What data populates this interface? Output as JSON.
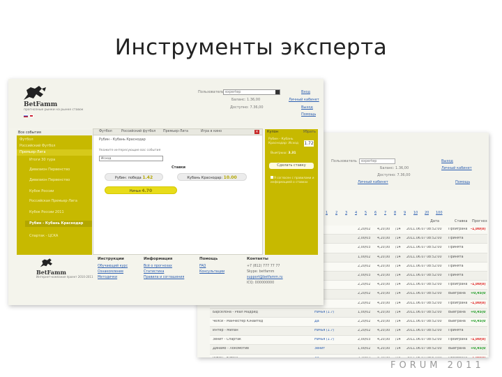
{
  "slide_title": "Инструменты эксперта",
  "forum_mark": "FORUM 2011",
  "front": {
    "brand": "BetFamm",
    "tagline": "прогнозные рынки на рынке ставок",
    "header": {
      "login_label": "Пользователь",
      "login_value": "expertep",
      "balance_label": "Баланс: 1.36,00",
      "bonus_label": "Доступно: 7.36,00",
      "right_links": [
        "Вход",
        "Личный кабинет",
        "Выход",
        "Помощь"
      ]
    },
    "nav": {
      "top_label": "Все события",
      "items": [
        {
          "label": "Футбол",
          "level": 1
        },
        {
          "label": "Российский Футбол",
          "level": 1
        },
        {
          "label": "Премьер-Лига",
          "level": 1
        },
        {
          "label": "Итоги 30 тура",
          "level": 2
        },
        {
          "label": "Дивизион Первенство",
          "level": 2
        },
        {
          "label": "Дивизион Первенство",
          "level": 2
        },
        {
          "label": "Кубок России",
          "level": 2
        },
        {
          "label": "Российская Премьер-Лига",
          "level": 2
        },
        {
          "label": "Кубок России 2011",
          "level": 2
        },
        {
          "label": "Рубин - Кубань Краснодар",
          "level": 2
        },
        {
          "label": "Спартак - ЦСКА",
          "level": 2
        }
      ]
    },
    "tabs": [
      "Футбол",
      "Российский футбол",
      "Премьер-Лига",
      "Игра в кино"
    ],
    "breadcrumb": "Рубин - Кубань Краснодар",
    "instruction": "Укажите интересующие вас события",
    "select_value": "Исход",
    "stake_label": "Ставки",
    "pills": [
      {
        "label": "Рубин: победа",
        "num": "1.42"
      },
      {
        "label": "Кубань Краснодар:",
        "num": "10.00"
      },
      {
        "label": "Ничья",
        "num": "4.70"
      }
    ],
    "slip": {
      "header": "Купон",
      "close": "Убрать",
      "bet": "Рубин - Кубань Краснодар: Исход",
      "odds": "1.72",
      "payout_label": "Выигрыш:",
      "payout_value": "3.31",
      "button": "Сделать ставку",
      "check_text": "Я согласен с правилами и информацией о ставках"
    },
    "footer": {
      "brand": "BetFamm",
      "tagline": "Интернет-компания проект 2010-2011",
      "cols": [
        {
          "title": "Инструкции",
          "links": [
            "Обучающий курс",
            "Ознакомление",
            "Методички"
          ]
        },
        {
          "title": "Информация",
          "links": [
            "Всё о прогнозах",
            "Статистика",
            "Правила и соглашения"
          ]
        },
        {
          "title": "Помощь",
          "links": [
            "FAQ",
            "Консультации"
          ]
        },
        {
          "title": "Контакты",
          "texts": [
            "+7 (812) 777 77 77",
            "Skype: betfamm",
            "support@betfamm.ru",
            "ICQ: 000000000"
          ]
        }
      ]
    }
  },
  "back": {
    "header": {
      "login_label": "Пользователь",
      "login_value": "expertep",
      "balance_label": "Баланс: 1.36,00",
      "bonus_label": "Доступно: 7.36,00",
      "link": "Личный кабинет",
      "right_links": [
        "Выход",
        "Личный кабинет",
        "Помощь"
      ]
    },
    "pager": [
      "1",
      "2",
      "3",
      "4",
      "5",
      "6",
      "7",
      "8",
      "9",
      "10",
      "20",
      "100"
    ],
    "columns": [
      "Дата",
      "Ставка",
      "Прогноз"
    ],
    "rows": [
      {
        "event": "",
        "bet": "",
        "c1": "2,20/02",
        "c2": "4,20,00",
        "c3": "/14",
        "date": "2011.06.07 08:52:00",
        "stat": "Проиграна",
        "amt": "-1,00(0)",
        "color": "red"
      },
      {
        "event": "",
        "bet": "",
        "c1": "2,00/03",
        "c2": "4,20,00",
        "c3": "/14",
        "date": "2011.06.07 08:52:00",
        "stat": "Принята",
        "amt": "",
        "color": ""
      },
      {
        "event": "",
        "bet": "",
        "c1": "2,00/03",
        "c2": "4,20,00",
        "c3": "/14",
        "date": "2011.06.07 08:52:00",
        "stat": "Принята",
        "amt": "",
        "color": ""
      },
      {
        "event": "",
        "bet": "",
        "c1": "1,00/02",
        "c2": "4,20,00",
        "c3": "/14",
        "date": "2011.06.07 08:52:00",
        "stat": "Принята",
        "amt": "",
        "color": ""
      },
      {
        "event": "",
        "bet": "",
        "c1": "2,20/02",
        "c2": "4,20,00",
        "c3": "/14",
        "date": "2011.06.07 08:52:00",
        "stat": "Принята",
        "amt": "",
        "color": ""
      },
      {
        "event": "",
        "bet": "",
        "c1": "2,00/03",
        "c2": "4,20,00",
        "c3": "/14",
        "date": "2011.06.07 08:52:00",
        "stat": "Принята",
        "amt": "",
        "color": ""
      },
      {
        "event": "",
        "bet": "",
        "c1": "2,20/02",
        "c2": "4,20,00",
        "c3": "/14",
        "date": "2011.06.07 08:52:00",
        "stat": "Проиграна",
        "amt": "-1,00(0)",
        "color": "red"
      },
      {
        "event": "",
        "bet": "",
        "c1": "2,20/02",
        "c2": "4,20,00",
        "c3": "/14",
        "date": "2011.06.07 08:52:00",
        "stat": "Выиграна",
        "amt": "+0,45(0)",
        "color": "green"
      },
      {
        "event": "",
        "bet": "",
        "c1": "2,20/02",
        "c2": "4,20,00",
        "c3": "/14",
        "date": "2011.06.07 08:52:00",
        "stat": "Проиграна",
        "amt": "-1,00(0)",
        "color": "red"
      },
      {
        "event": "Барселона - Реал Мадрид",
        "bet": "Ничья (1.7)",
        "c1": "1,00/02",
        "c2": "4,20,00",
        "c3": "/14",
        "date": "2011.06.07 08:52:00",
        "stat": "Выиграна",
        "amt": "+0,45(0)",
        "color": "green"
      },
      {
        "event": "Челси - Манчестер Юнайтед",
        "bet": "Да",
        "c1": "2,20/02",
        "c2": "4,20,00",
        "c3": "/14",
        "date": "2011.06.07 08:52:00",
        "stat": "Выиграна",
        "amt": "+0,45(0)",
        "color": "green"
      },
      {
        "event": "Интер - Милан",
        "bet": "Ничья (1.7)",
        "c1": "2,20/02",
        "c2": "4,20,00",
        "c3": "/14",
        "date": "2011.06.07 08:52:00",
        "stat": "Принята",
        "amt": "",
        "color": ""
      },
      {
        "event": "Зенит - Спартак",
        "bet": "Ничья (1.7)",
        "c1": "2,00/03",
        "c2": "4,20,00",
        "c3": "/14",
        "date": "2011.06.07 08:52:00",
        "stat": "Проиграна",
        "amt": "-1,00(0)",
        "color": "red"
      },
      {
        "event": "Динамо - Локомотив",
        "bet": "Зенит",
        "c1": "1,00/02",
        "c2": "4,20,00",
        "c3": "/14",
        "date": "2011.06.07 08:52:00",
        "stat": "Выиграна",
        "amt": "+0,45(0)",
        "color": "green"
      },
      {
        "event": "Рубин - Кубань",
        "bet": "Да",
        "c1": "2,20/02",
        "c2": "4,20,00",
        "c3": "/14",
        "date": "2011.06.07 08:52:00",
        "stat": "Проиграна",
        "amt": "-1,00(0)",
        "color": "red"
      }
    ]
  },
  "colors": {
    "nav_yellow": "#c7b900",
    "pill_yellow": "#e8dc1a",
    "link_blue": "#2a5db0",
    "loss_red": "#e02020",
    "win_green": "#1a9a20"
  }
}
